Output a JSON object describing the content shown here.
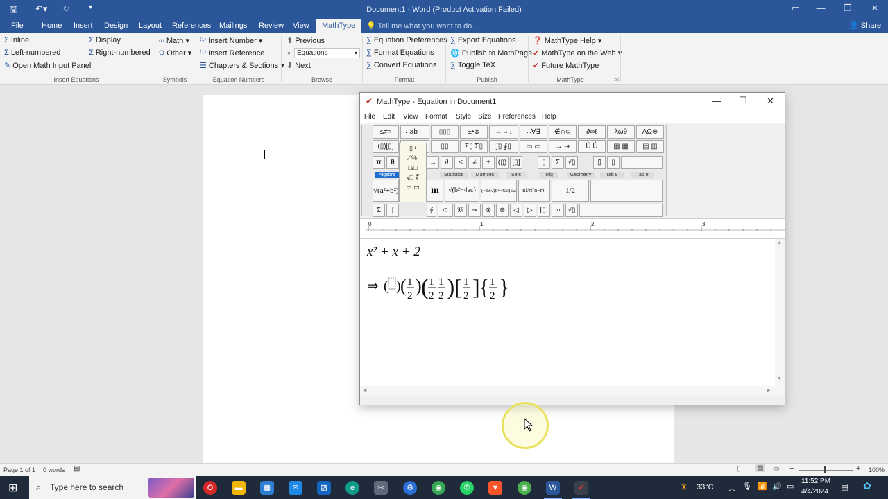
{
  "app": {
    "title": "Document1 - Word (Product Activation Failed)",
    "tabs": [
      "File",
      "Home",
      "Insert",
      "Design",
      "Layout",
      "References",
      "Mailings",
      "Review",
      "View",
      "MathType"
    ],
    "active_tab": "MathType",
    "tell_me": "Tell me what you want to do...",
    "share": "Share"
  },
  "ribbon": {
    "insert_equations": {
      "label": "Insert Equations",
      "inline": "Inline",
      "display": "Display",
      "left_numbered": "Left-numbered",
      "right_numbered": "Right-numbered",
      "open_panel": "Open Math Input Panel"
    },
    "symbols": {
      "label": "Symbols",
      "math": "Math",
      "other": "Other"
    },
    "equation_numbers": {
      "label": "Equation Numbers",
      "insert_number": "Insert Number",
      "insert_reference": "Insert Reference",
      "chapters_sections": "Chapters & Sections"
    },
    "browse": {
      "label": "Browse",
      "previous": "Previous",
      "equations": "Equations",
      "next": "Next"
    },
    "format": {
      "label": "Format",
      "preferences": "Equation Preferences",
      "format_eq": "Format Equations",
      "convert": "Convert Equations"
    },
    "publish": {
      "label": "Publish",
      "export": "Export Equations",
      "publish_mathpage": "Publish to MathPage",
      "toggle_tex": "Toggle TeX"
    },
    "mathtype": {
      "label": "MathType",
      "help": "MathType Help",
      "web": "MathType on the Web",
      "future": "Future MathType"
    }
  },
  "status": {
    "page": "Page 1 of 1",
    "words": "0 words",
    "zoom": "100%"
  },
  "mathtype_window": {
    "title": "MathType - Equation in Document1",
    "menu": [
      "File",
      "Edit",
      "View",
      "Format",
      "Style",
      "Size",
      "Preferences",
      "Help"
    ],
    "palette_row1": [
      "≤≠≈",
      "∴ab·∵",
      "▯▯▯",
      "±•⊗",
      "→⇔↓",
      "∴∀∃",
      "∉∩⊂",
      "∂∞ℓ",
      "λωθ",
      "ΛΩ⊗"
    ],
    "palette_row2": [
      "(▯)[▯]",
      "▯/▯ √▯",
      "▯▯",
      "Σ▯ Σ▯",
      "∫▯ ∮▯",
      "▭ ▭",
      "→ ⇝",
      "Ū Ů",
      "▦ ▦",
      "▤ ▥"
    ],
    "palette_row3": [
      "π",
      "θ",
      "→",
      "∂",
      "≤",
      "≠",
      "±",
      "(▯)",
      "[▯]",
      "▯",
      "Σ",
      "√▯",
      "▯̄",
      "▯"
    ],
    "tab_labels": [
      "Algebra",
      "Statistics",
      "Matrices",
      "Sets",
      "Trig",
      "Geometry",
      "Tab 8",
      "Tab 9"
    ],
    "templates": [
      "√(a²+b²)",
      "m",
      "√(b²−4ac)",
      "(−b±√(b²−4ac))/2a",
      "n!/r!(n−r)!",
      "1/2"
    ],
    "palette_row5": [
      "Σ",
      "∫",
      "∮",
      "⊂",
      "𝔐",
      "⊸",
      "⊗",
      "⊕",
      "◁",
      "▷",
      "[▯]",
      "∞",
      "√▯"
    ],
    "ruler_marks": [
      "0",
      "1",
      "2",
      "3"
    ],
    "equation_line1": "x² + x + 2",
    "equation_line2": "⇒ (▯)(1/2)(1 1/2 2)[1/2]{1/2}"
  },
  "taskbar": {
    "search": "Type here to search",
    "temp": "33°C",
    "time": "11:52 PM",
    "date": "4/4/2024"
  },
  "colors": {
    "word_blue": "#2b579a",
    "highlight": "#e9e15c"
  }
}
